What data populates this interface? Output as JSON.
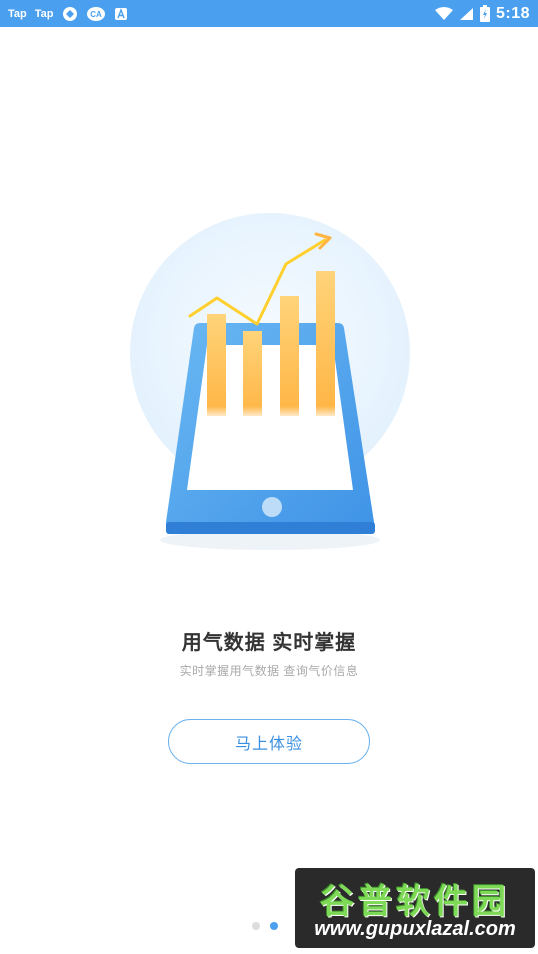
{
  "status_bar": {
    "app_icons": [
      "Tap",
      "Tap"
    ],
    "time": "5:18"
  },
  "content": {
    "headline": "用气数据 实时掌握",
    "subline": "实时掌握用气数据 查询气价信息",
    "cta_label": "马上体验"
  },
  "pager": {
    "count": 2,
    "active_index": 1
  },
  "watermark": {
    "title": "谷普软件园",
    "url": "www.gupuxlazal.com"
  },
  "colors": {
    "status_bar": "#4aa0ef",
    "accent": "#3a8fe0",
    "bar_gold": "#ffc15a",
    "tablet_blue": "#4aa0ef"
  }
}
